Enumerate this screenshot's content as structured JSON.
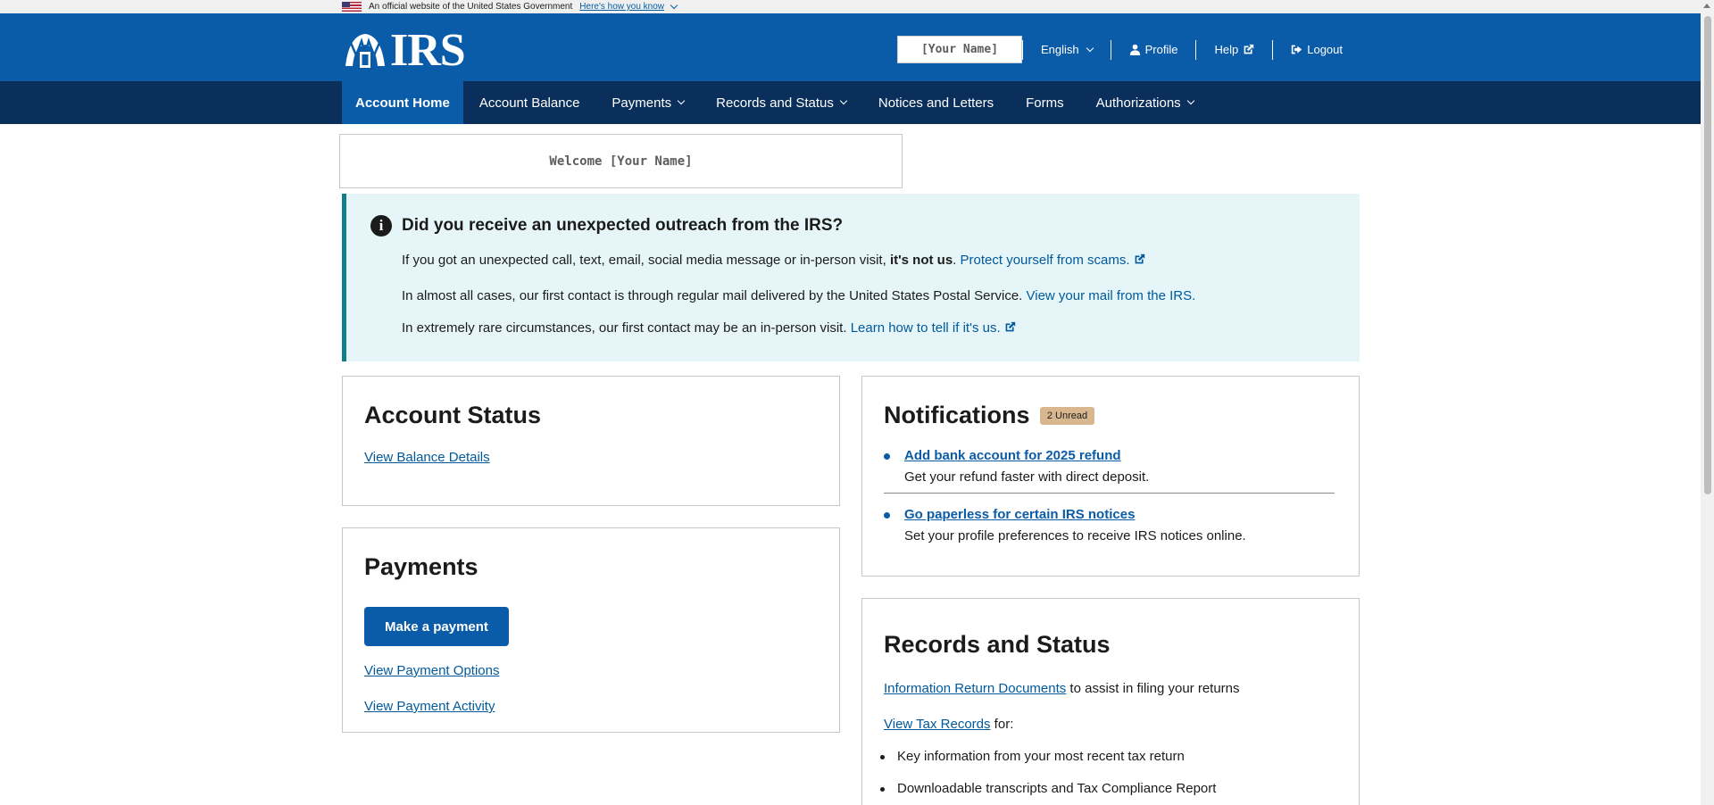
{
  "gov_banner": {
    "text": "An official website of the United States Government",
    "link": "Here's how you know"
  },
  "header": {
    "logo_text": "IRS",
    "user_name": "[Your Name]",
    "language": "English",
    "profile": "Profile",
    "help": "Help",
    "logout": "Logout"
  },
  "nav": {
    "items": [
      {
        "label": "Account Home"
      },
      {
        "label": "Account Balance"
      },
      {
        "label": "Payments"
      },
      {
        "label": "Records and Status"
      },
      {
        "label": "Notices and Letters"
      },
      {
        "label": "Forms"
      },
      {
        "label": "Authorizations"
      }
    ]
  },
  "welcome": "Welcome [Your Name]",
  "alert": {
    "title": "Did you receive an unexpected outreach from the IRS?",
    "p1_text": "If you got an unexpected call, text, email, social media message or in-person visit, ",
    "p1_bold": "it's not us",
    "p1_after": ". ",
    "p1_link": "Protect yourself from scams.",
    "p2_text": "In almost all cases, our first contact is through regular mail delivered by the United States Postal Service. ",
    "p2_link": "View your mail from the IRS.",
    "p3_text": "In extremely rare circumstances, our first contact may be an in-person visit. ",
    "p3_link": "Learn how to tell if it's us."
  },
  "account_status": {
    "title": "Account Status",
    "link": "View Balance Details"
  },
  "payments": {
    "title": "Payments",
    "button": "Make a payment",
    "link1": "View Payment Options",
    "link2": "View Payment Activity"
  },
  "notifications": {
    "title": "Notifications",
    "badge": "2 Unread",
    "items": [
      {
        "title": "Add bank account for 2025 refund",
        "desc": "Get your refund faster with direct deposit."
      },
      {
        "title": "Go paperless for certain IRS notices",
        "desc": "Set your profile preferences to receive IRS notices online."
      }
    ]
  },
  "records": {
    "title": "Records and Status",
    "line1_link": "Information Return Documents",
    "line1_text": " to assist in filing your returns",
    "line2_link": "View Tax Records",
    "line2_text": " for:",
    "bullets": [
      "Key information from your most recent tax return",
      "Downloadable transcripts and Tax Compliance Report"
    ]
  },
  "colors": {
    "header_blue": "#0b5ca8",
    "nav_navy": "#0a2f5a",
    "alert_bg": "#e6f6f8",
    "link": "#00599c",
    "badge": "#d9b78e"
  }
}
